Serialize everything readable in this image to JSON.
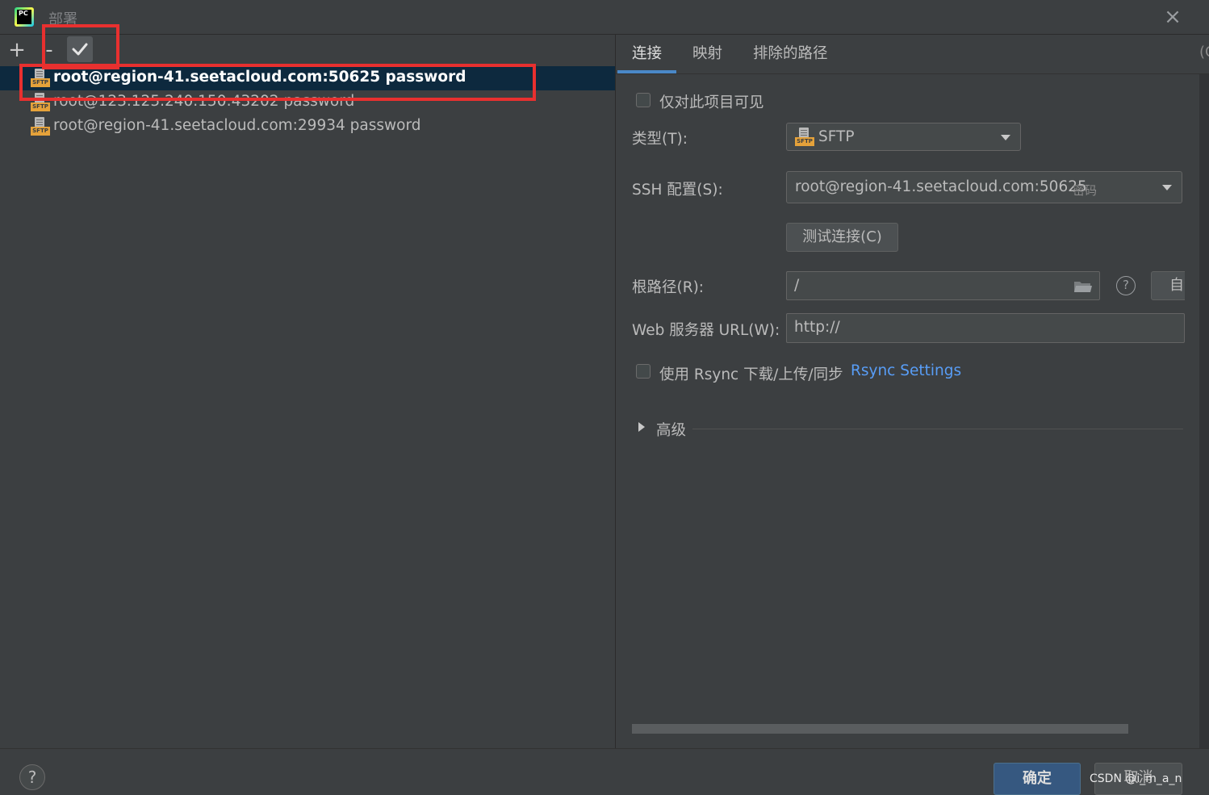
{
  "window": {
    "title": "部署",
    "app_logo_text": "PC"
  },
  "toolbar": {
    "add_label": "+",
    "remove_label": "-"
  },
  "servers": [
    {
      "label": "root@region-41.seetacloud.com:50625 password",
      "icon_tag": "SFTP",
      "selected": true
    },
    {
      "label": "root@123.125.240.150:43202 password",
      "icon_tag": "SFTP",
      "selected": false
    },
    {
      "label": "root@region-41.seetacloud.com:29934 password",
      "icon_tag": "SFTP",
      "selected": false
    }
  ],
  "tabs": [
    {
      "label": "连接",
      "active": true
    },
    {
      "label": "映射",
      "active": false
    },
    {
      "label": "排除的路径",
      "active": false
    }
  ],
  "tabs_overflow_char": "(C",
  "connection": {
    "visible_only_label": "仅对此项目可见",
    "type_label": "类型(T):",
    "type_value": "SFTP",
    "type_icon_tag": "SFTP",
    "ssh_label": "SSH 配置(S):",
    "ssh_value": "root@region-41.seetacloud.com:50625",
    "ssh_value_suffix": "密码",
    "test_button": "测试连接(C)",
    "root_label": "根路径(R):",
    "root_value": "/",
    "auto_button": "自动",
    "web_url_label": "Web 服务器 URL(W):",
    "web_url_value": "http://",
    "rsync_label": "使用 Rsync 下载/上传/同步",
    "rsync_link": "Rsync Settings",
    "advanced_label": "高级"
  },
  "footer": {
    "help_label": "?",
    "ok_label": "确定",
    "cancel_label": "取消",
    "watermark": "CSDN @i_m_a_n"
  },
  "colors": {
    "background": "#3c3f41",
    "selection": "#0d293e",
    "accent": "#4a88c7",
    "link": "#589df6",
    "primary_button": "#365880",
    "annotation": "#e8302f"
  }
}
